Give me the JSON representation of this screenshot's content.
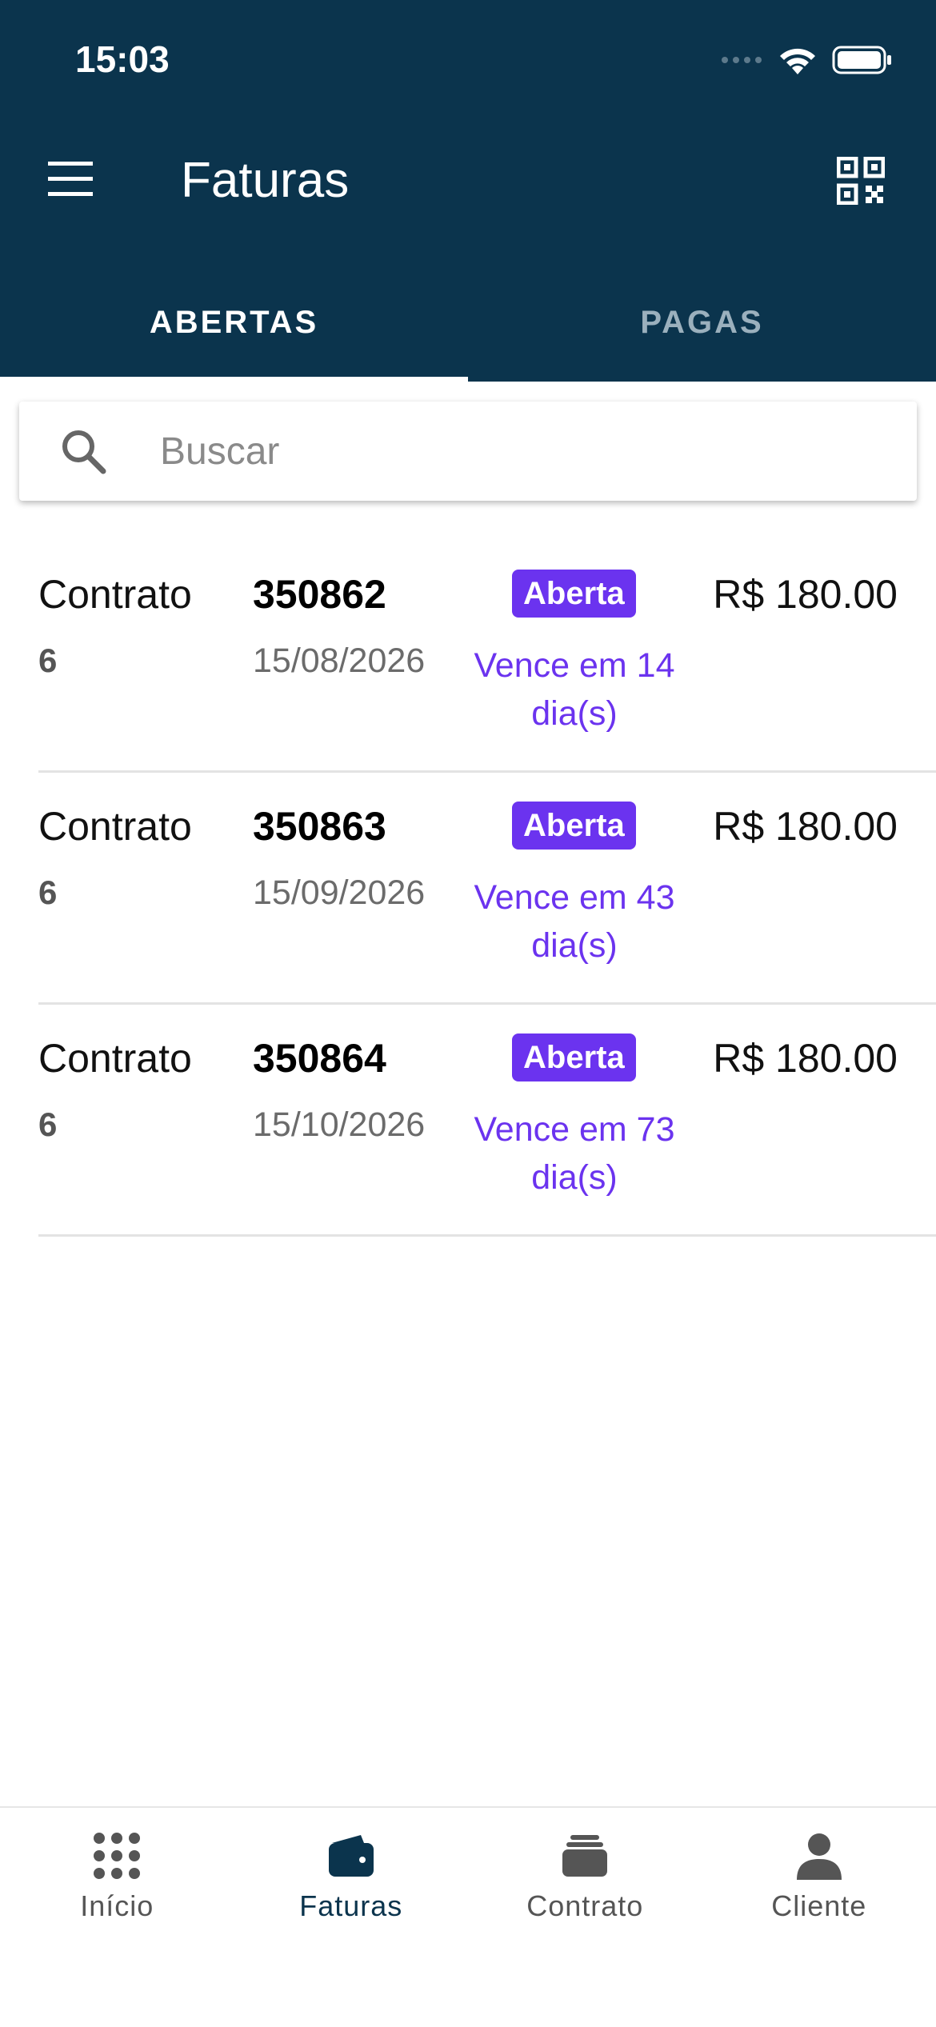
{
  "status_bar": {
    "time": "15:03"
  },
  "header": {
    "title": "Faturas",
    "menu_icon": "hamburger-menu-icon",
    "qr_icon": "qr-code-icon"
  },
  "tabs": [
    {
      "label": "ABERTAS",
      "active": true
    },
    {
      "label": "PAGAS",
      "active": false
    }
  ],
  "search": {
    "placeholder": "Buscar",
    "value": ""
  },
  "invoices": [
    {
      "contract_label": "Contrato",
      "contract_number": "6",
      "invoice_id": "350862",
      "due_date": "15/08/2026",
      "status": "Aberta",
      "due_line1": "Vence em 14",
      "due_line2": "dia(s)",
      "amount": "R$ 180.00"
    },
    {
      "contract_label": "Contrato",
      "contract_number": "6",
      "invoice_id": "350863",
      "due_date": "15/09/2026",
      "status": "Aberta",
      "due_line1": "Vence em 43",
      "due_line2": "dia(s)",
      "amount": "R$ 180.00"
    },
    {
      "contract_label": "Contrato",
      "contract_number": "6",
      "invoice_id": "350864",
      "due_date": "15/10/2026",
      "status": "Aberta",
      "due_line1": "Vence em 73",
      "due_line2": "dia(s)",
      "amount": "R$ 180.00"
    }
  ],
  "bottom_nav": [
    {
      "label": "Início",
      "icon": "grid-dots-icon",
      "active": false
    },
    {
      "label": "Faturas",
      "icon": "wallet-icon",
      "active": true
    },
    {
      "label": "Contrato",
      "icon": "stack-icon",
      "active": false
    },
    {
      "label": "Cliente",
      "icon": "person-icon",
      "active": false
    }
  ],
  "colors": {
    "header_bg": "#0b344d",
    "accent_purple": "#6b33ef",
    "nav_active": "#0b344d",
    "nav_inactive": "#555555"
  }
}
